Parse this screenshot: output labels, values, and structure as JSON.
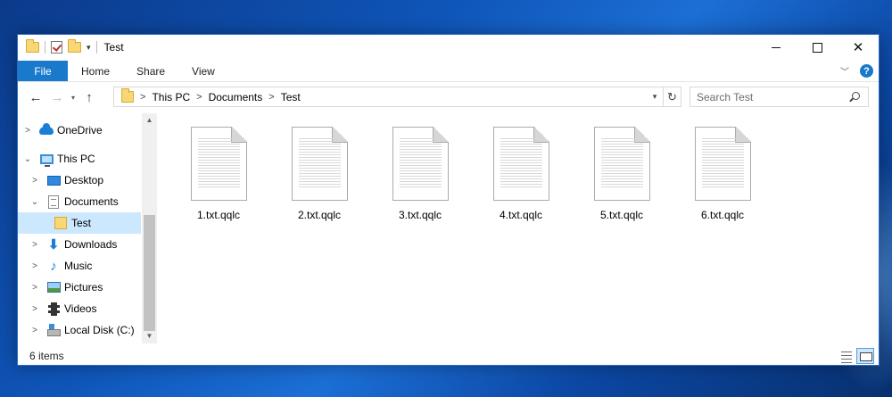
{
  "window": {
    "title": "Test",
    "controls": {
      "minimize": "",
      "maximize": "",
      "close": "✕"
    }
  },
  "ribbon": {
    "tabs": [
      "File",
      "Home",
      "Share",
      "View"
    ],
    "expand_icon": "chevron-down-icon",
    "help_icon": "?"
  },
  "navigation": {
    "back": "←",
    "forward": "→",
    "recent": "⌄",
    "up": "↑"
  },
  "address": {
    "breadcrumbs": [
      "This PC",
      "Documents",
      "Test"
    ],
    "separator": ">"
  },
  "search": {
    "placeholder": "Search Test",
    "value": ""
  },
  "nav_pane": {
    "items": [
      {
        "label": "OneDrive",
        "icon": "onedrive-icon",
        "expander": ">"
      },
      {
        "label": "This PC",
        "icon": "computer-icon",
        "expander": "⌄"
      },
      {
        "label": "Desktop",
        "icon": "desktop-icon",
        "expander": ">"
      },
      {
        "label": "Documents",
        "icon": "documents-icon",
        "expander": "⌄"
      },
      {
        "label": "Test",
        "icon": "folder-icon",
        "expander": "",
        "selected": true
      },
      {
        "label": "Downloads",
        "icon": "downloads-icon",
        "expander": ">"
      },
      {
        "label": "Music",
        "icon": "music-icon",
        "expander": ">"
      },
      {
        "label": "Pictures",
        "icon": "pictures-icon",
        "expander": ">"
      },
      {
        "label": "Videos",
        "icon": "videos-icon",
        "expander": ">"
      },
      {
        "label": "Local Disk (C:)",
        "icon": "local-disk-icon",
        "expander": ">"
      }
    ]
  },
  "files": [
    {
      "name": "1.txt.qqlc",
      "icon": "text-document-icon"
    },
    {
      "name": "2.txt.qqlc",
      "icon": "text-document-icon"
    },
    {
      "name": "3.txt.qqlc",
      "icon": "text-document-icon"
    },
    {
      "name": "4.txt.qqlc",
      "icon": "text-document-icon"
    },
    {
      "name": "5.txt.qqlc",
      "icon": "text-document-icon"
    },
    {
      "name": "6.txt.qqlc",
      "icon": "text-document-icon"
    }
  ],
  "status": {
    "item_count": "6 items"
  },
  "colors": {
    "accent": "#1979ca",
    "selection": "#cce8ff",
    "folder": "#f8d775"
  }
}
